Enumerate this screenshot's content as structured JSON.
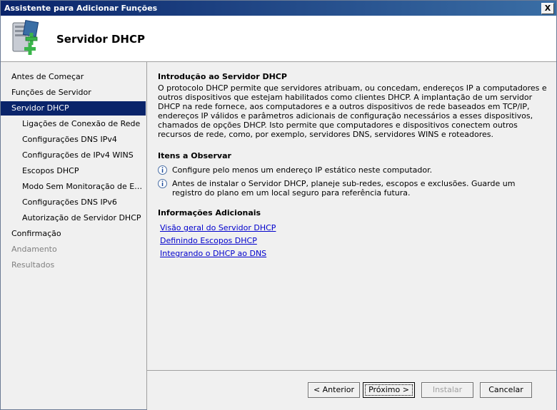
{
  "window": {
    "title": "Assistente para Adicionar Funções",
    "close_label": "X"
  },
  "header": {
    "title": "Servidor DHCP",
    "icon": "server-add-icon"
  },
  "nav": [
    {
      "label": "Antes de Começar",
      "level": 1,
      "state": "normal"
    },
    {
      "label": "Funções de Servidor",
      "level": 1,
      "state": "normal"
    },
    {
      "label": "Servidor DHCP",
      "level": 1,
      "state": "selected"
    },
    {
      "label": "Ligações de Conexão de Rede",
      "level": 2,
      "state": "normal"
    },
    {
      "label": "Configurações DNS IPv4",
      "level": 2,
      "state": "normal"
    },
    {
      "label": "Configurações de IPv4 WINS",
      "level": 2,
      "state": "normal"
    },
    {
      "label": "Escopos DHCP",
      "level": 2,
      "state": "normal"
    },
    {
      "label": "Modo Sem Monitoração de Est...",
      "level": 2,
      "state": "normal"
    },
    {
      "label": "Configurações DNS IPv6",
      "level": 2,
      "state": "normal"
    },
    {
      "label": "Autorização de Servidor DHCP",
      "level": 2,
      "state": "normal"
    },
    {
      "label": "Confirmação",
      "level": 1,
      "state": "normal"
    },
    {
      "label": "Andamento",
      "level": 1,
      "state": "disabled"
    },
    {
      "label": "Resultados",
      "level": 1,
      "state": "disabled"
    }
  ],
  "content": {
    "intro_title": "Introdução ao Servidor DHCP",
    "intro_text": "O protocolo DHCP permite que servidores atribuam, ou concedam, endereços IP a computadores e outros dispositivos que estejam habilitados como clientes DHCP. A implantação de um servidor DHCP na rede fornece, aos computadores e a outros dispositivos de rede baseados em TCP/IP, endereços IP válidos e parâmetros adicionais de configuração necessários a esses dispositivos, chamados de opções DHCP. Isto permite que computadores e dispositivos conectem outros recursos de rede, como, por exemplo, servidores DNS, servidores WINS e roteadores.",
    "notes_title": "Itens a Observar",
    "notes": [
      "Configure pelo menos um endereço IP estático neste computador.",
      "Antes de instalar o Servidor DHCP, planeje sub-redes, escopos e exclusões. Guarde um registro do plano em um local seguro para referência futura."
    ],
    "more_title": "Informações Adicionais",
    "links": [
      "Visão geral do Servidor DHCP",
      "Definindo Escopos DHCP",
      "Integrando o DHCP ao DNS"
    ]
  },
  "buttons": {
    "back": "< Anterior",
    "next": "Próximo >",
    "install": "Instalar",
    "cancel": "Cancelar"
  }
}
